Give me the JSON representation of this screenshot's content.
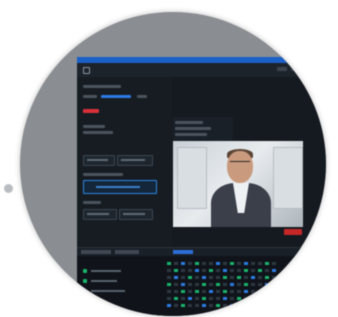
{
  "app": {
    "menu": [],
    "title": "",
    "colors": {
      "menubar": "#1b5fc8",
      "panel_bg": "#151a20",
      "accent_blue": "#2c7be5",
      "record_red": "#d9303a",
      "status_green": "#19b36b"
    }
  },
  "left_panel": {
    "buttons": [
      {
        "label": ""
      },
      {
        "label": ""
      },
      {
        "label": ""
      },
      {
        "label": ""
      },
      {
        "label": ""
      }
    ]
  },
  "video_preview": {
    "subject": "portrait-video-feed"
  },
  "bottom_panel": {
    "tabs": [
      {
        "label": ""
      },
      {
        "label": ""
      },
      {
        "label": ""
      }
    ],
    "list_items": [
      {
        "label": ""
      },
      {
        "label": ""
      },
      {
        "label": ""
      }
    ]
  }
}
